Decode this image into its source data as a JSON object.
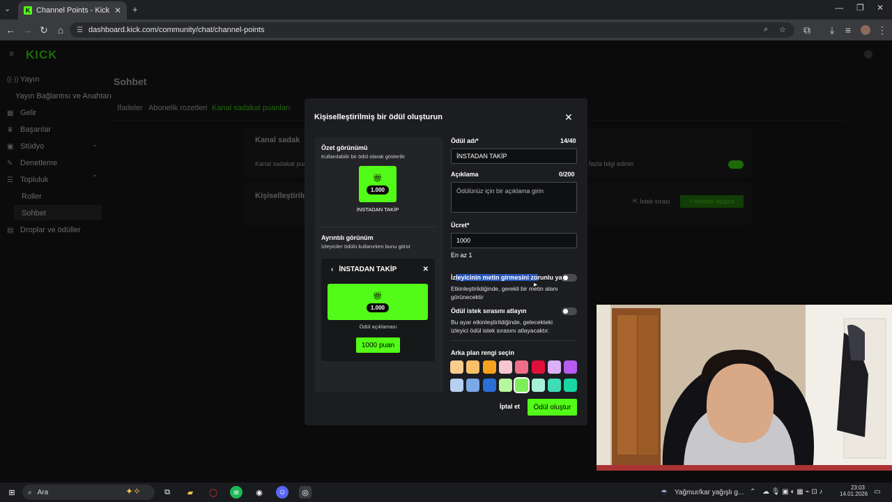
{
  "browser": {
    "tab_title": "Channel Points - Kick Dashboard",
    "url": "dashboard.kick.com/community/chat/channel-points"
  },
  "sidebar": {
    "logo": "KICK",
    "items": [
      {
        "label": "Yayın"
      },
      {
        "label": "Yayın Bağlantısı ve Anahtarı"
      },
      {
        "label": "Gelir"
      },
      {
        "label": "Başarılar"
      },
      {
        "label": "Stüdyo"
      },
      {
        "label": "Denetleme"
      },
      {
        "label": "Topluluk"
      },
      {
        "label": "Roller"
      },
      {
        "label": "Sohbet"
      },
      {
        "label": "Droplar ve ödüller"
      }
    ]
  },
  "page": {
    "title": "Sohbet",
    "tabs": [
      "İfadeler",
      "Abonelik rozetleri",
      "Kanal sadakat puanları"
    ],
    "section1_title": "Kanal sadak",
    "section1_text": "Kanal sadakat pua",
    "more_info": "fazla bilgi edinin",
    "section2_title": "Kişiselleştirilm",
    "queue_label": "İstek sırası",
    "create_new_label": "Yenisini oluştur"
  },
  "modal": {
    "title": "Kişiselleştirilmiş bir ödül oluşturun",
    "summary_title": "Özet görünümü",
    "summary_sub": "Kullanılabilir bir ödül olarak gösterilir",
    "reward_cost_badge": "1.000",
    "reward_name_preview": "İNSTADAN TAKİP",
    "detail_title": "Ayrıntılı görünüm",
    "detail_sub": "İzleyiciler ödülü kullanırken bunu görür",
    "detail_header": "İNSTADAN TAKİP",
    "detail_desc": "Ödül açıklaması",
    "detail_button": "1000 puan",
    "name_label": "Ödül adı*",
    "name_count": "14/40",
    "name_value": "İNSTADAN TAKİP",
    "desc_label": "Açıklama",
    "desc_count": "0/200",
    "desc_placeholder": "Ödülünüz için bir açıklama girin",
    "cost_label": "Ücret*",
    "cost_value": "1000",
    "cost_hint": "En az 1",
    "require_text_prefix": "İz",
    "require_text_hl": "leyicinin metin girmesini zo",
    "require_text_suffix": "runlu yap",
    "require_text_desc": "Etkinleştirildiğinde, gerekli bir metin alanı görünecektir",
    "skip_queue_label": "Ödül istek sırasını atlayın",
    "skip_queue_desc": "Bu ayar etkinleştirildiğinde, gelecekteki izleyici ödül istek sırasını atlayacaktır.",
    "bg_color_label": "Arka plan rengi seçin",
    "colors_row1": [
      "#f9cd8e",
      "#fbc16a",
      "#f6a21e",
      "#f7c6d1",
      "#ee6e8a",
      "#e0103a",
      "#dcb0f6",
      "#b65cf2"
    ],
    "colors_row2": [
      "#b6d0f2",
      "#7aa9e8",
      "#2a6fd6",
      "#b6f7a0",
      "#7cf05a",
      "#a6f2d8",
      "#3fdcb7",
      "#19d7a4"
    ],
    "selected_color": "#7cf05a",
    "cancel_label": "İptal et",
    "create_label": "Ödül oluştur"
  },
  "taskbar": {
    "search_placeholder": "Ara",
    "weather": "Yağmur/kar yağışlı g...",
    "time": "23:03",
    "date": "14.01.2026"
  }
}
